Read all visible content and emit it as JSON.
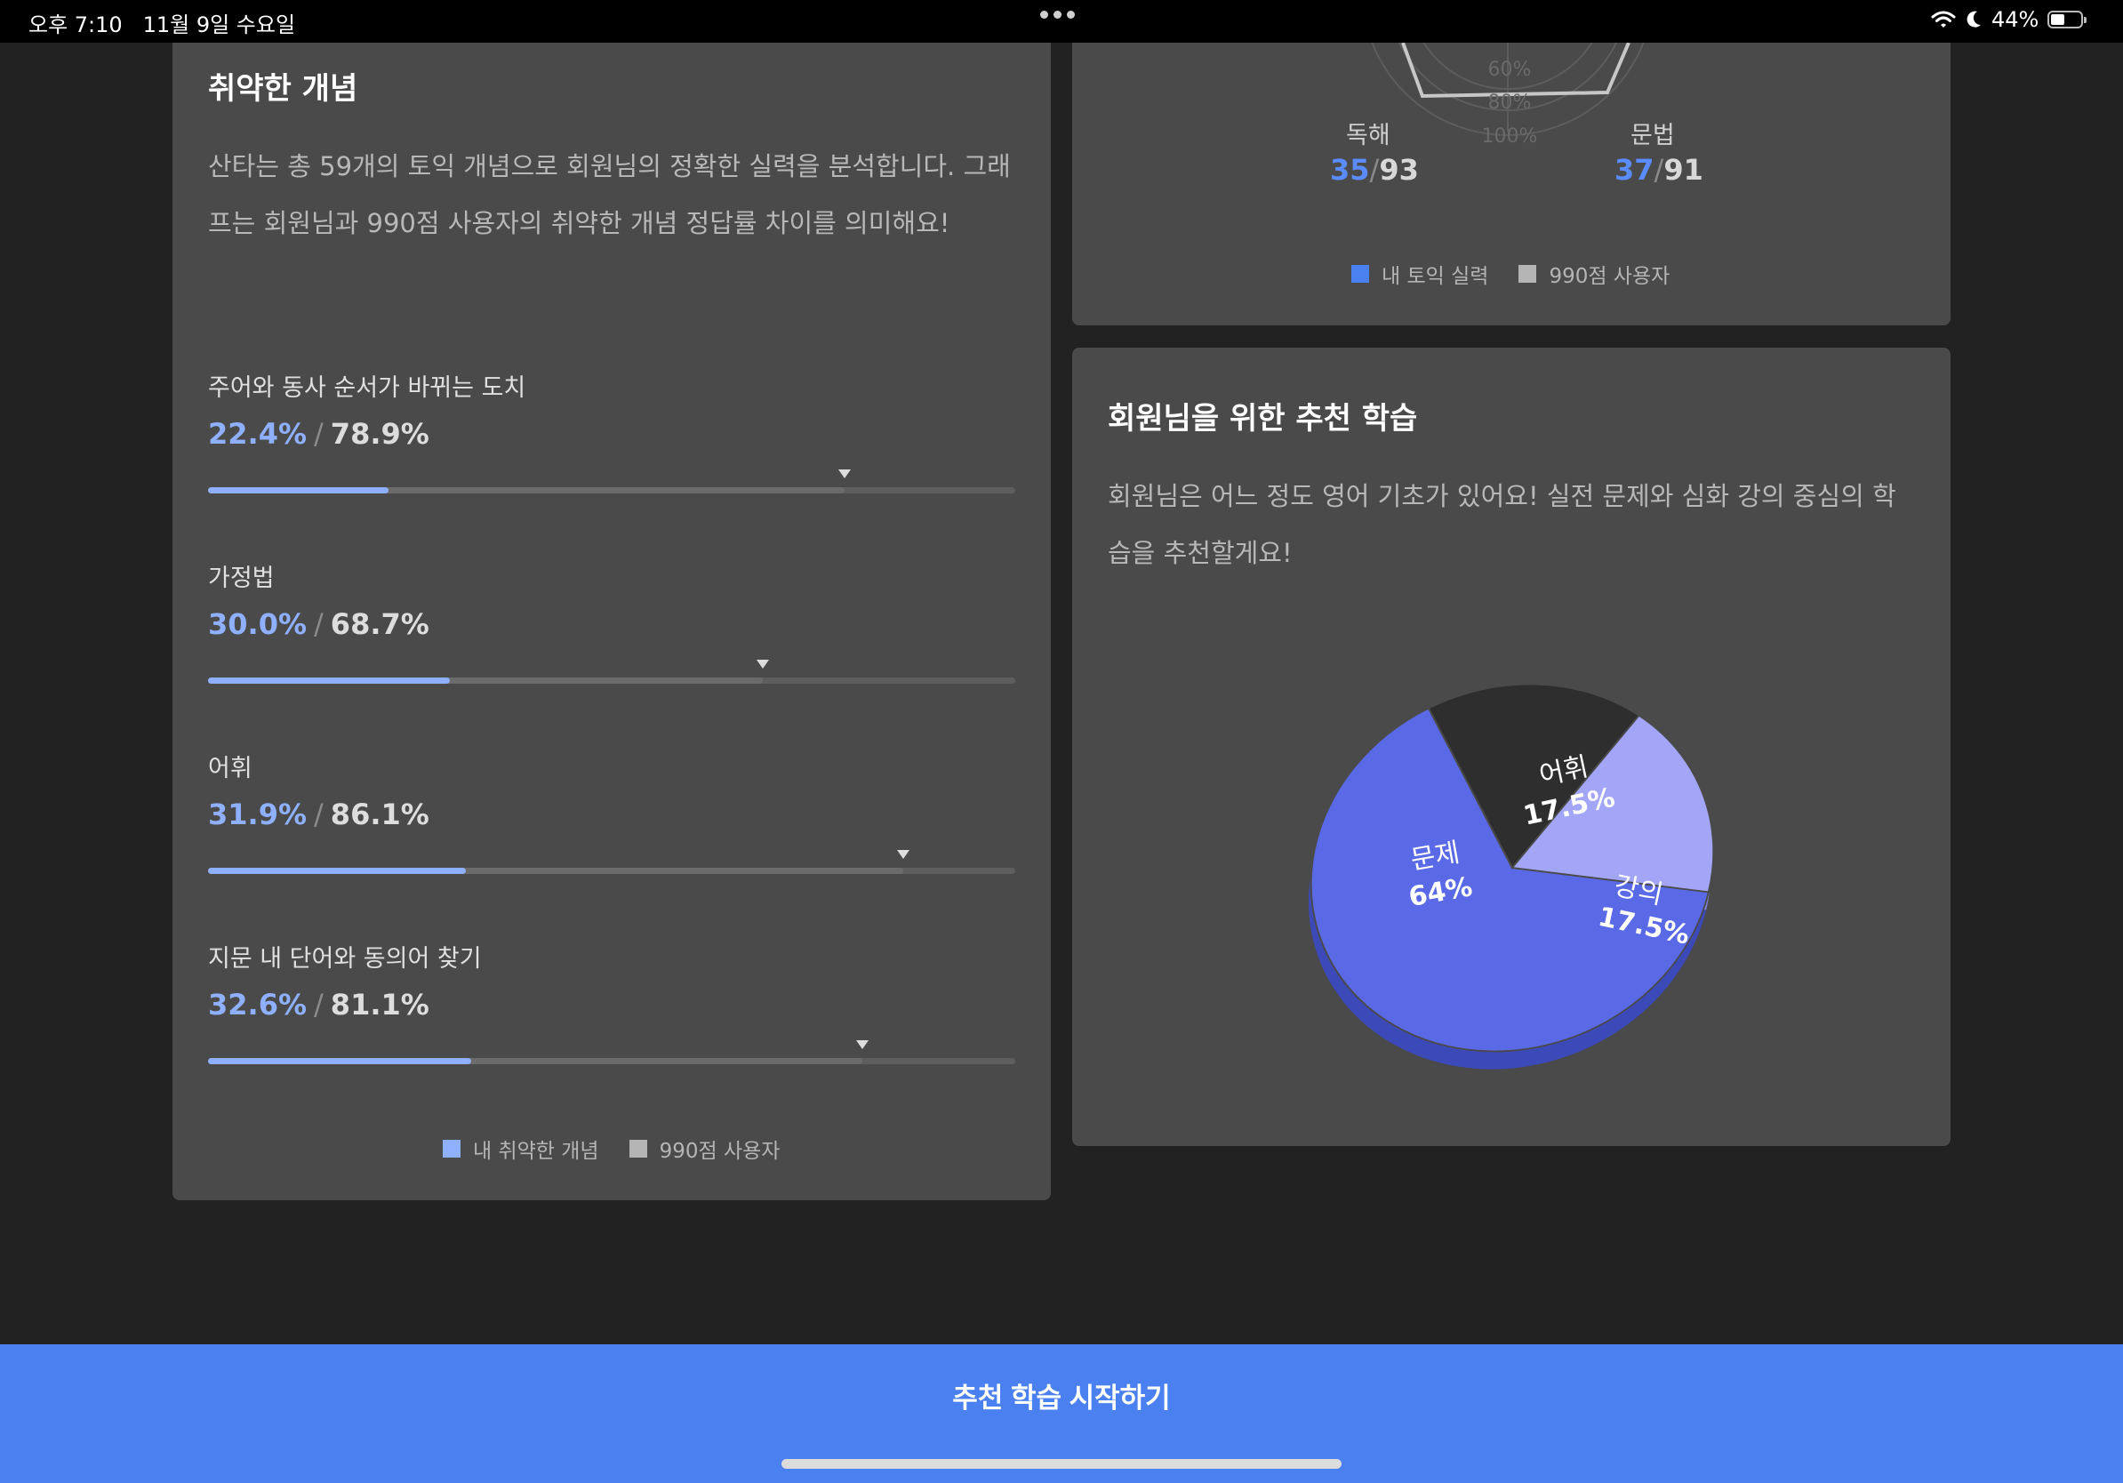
{
  "status_bar": {
    "time": "오후 7:10",
    "date": "11월 9일 수요일",
    "battery": "44%",
    "icons": [
      "wifi-icon",
      "moon-icon",
      "battery-icon"
    ]
  },
  "radar": {
    "rings": [
      "60%",
      "80%",
      "100%"
    ],
    "axes": [
      {
        "label": "독해",
        "mine": "35",
        "total": "93"
      },
      {
        "label": "문법",
        "mine": "37",
        "total": "91"
      }
    ],
    "legend": {
      "mine": "내 토익 실력",
      "top": "990점 사용자"
    }
  },
  "weak": {
    "title": "취약한 개념",
    "desc": "산타는 총 59개의 토익 개념으로 회원님의 정확한 실력을 분석합니다. 그래프는 회원님과 990점 사용자의 취약한 개념 정답률 차이를 의미해요!",
    "separator": "/",
    "concepts": [
      {
        "name": "주어와 동사 순서가 바뀌는 도치",
        "mine": "22.4%",
        "top": "78.9%",
        "mine_value": 22.4,
        "top_value": 78.9
      },
      {
        "name": "가정법",
        "mine": "30.0%",
        "top": "68.7%",
        "mine_value": 30.0,
        "top_value": 68.7
      },
      {
        "name": "어휘",
        "mine": "31.9%",
        "top": "86.1%",
        "mine_value": 31.9,
        "top_value": 86.1
      },
      {
        "name": "지문 내 단어와 동의어 찾기",
        "mine": "32.6%",
        "top": "81.1%",
        "mine_value": 32.6,
        "top_value": 81.1
      }
    ],
    "legend": {
      "mine": "내 취약한 개념",
      "top": "990점 사용자"
    }
  },
  "reco": {
    "title": "회원님을 위한 추천 학습",
    "desc": "회원님은 어느 정도 영어 기초가 있어요! 실전 문제와 심화 강의 중심의 학습을 추천할게요!",
    "pie": [
      {
        "label": "문제",
        "value_text": "64%",
        "value": 64
      },
      {
        "label": "어휘",
        "value_text": "17.5%",
        "value": 17.5
      },
      {
        "label": "강의",
        "value_text": "17.5%",
        "value": 17.5
      }
    ]
  },
  "cta": {
    "label": "추천 학습 시작하기"
  },
  "colors": {
    "accent": "#4a80f0",
    "mine": "#8fb0ff",
    "radar_mine": "#5b8cff",
    "pie_problem": "#5a6ae6",
    "pie_vocab": "#2e2e2e",
    "pie_lecture": "#a3a6f7"
  }
}
